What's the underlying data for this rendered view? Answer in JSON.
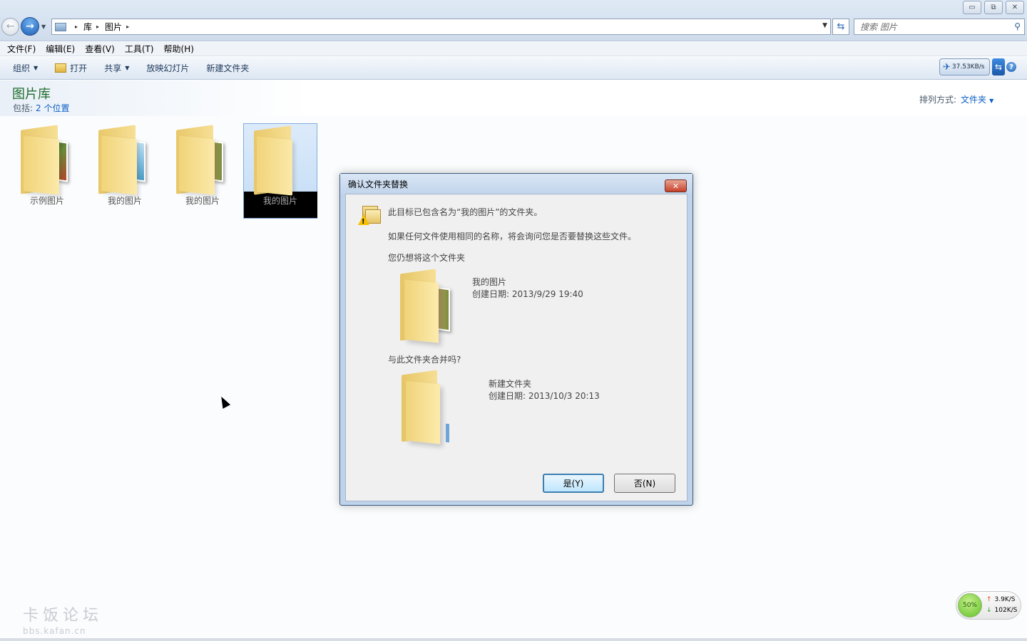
{
  "window": {
    "controls": {
      "minimize": "▭",
      "restore": "⧉",
      "close": "✕"
    }
  },
  "nav": {
    "back": "←",
    "forward": "→",
    "dropdown": "▼"
  },
  "address": {
    "crumbs": [
      "库",
      "图片"
    ],
    "separator": "▸",
    "dropdown": "▼"
  },
  "refresh": "⇆",
  "search": {
    "placeholder": "搜索 图片",
    "icon": "search-icon"
  },
  "menubar": [
    "文件(F)",
    "编辑(E)",
    "查看(V)",
    "工具(T)",
    "帮助(H)"
  ],
  "toolbar": {
    "organize": "组织",
    "open": "打开",
    "share": "共享",
    "slideshow": "放映幻灯片",
    "new_folder": "新建文件夹",
    "caret": "▼",
    "speed_value": "37.53KB/s",
    "sync_symbol": "⇆",
    "help_symbol": "?"
  },
  "library": {
    "title": "图片库",
    "includes_label": "包括:",
    "includes_link": "2 个位置",
    "sort_label": "排列方式:",
    "sort_value": "文件夹",
    "caret": "▼"
  },
  "folders": [
    {
      "label": "示例图片",
      "selected": false,
      "thumb_colors": [
        "#2f5a2a",
        "#b3472a",
        "#6c8d3b"
      ]
    },
    {
      "label": "我的图片",
      "selected": false,
      "thumb_colors": [
        "#8ec6e8",
        "#4a9cc4",
        "#d9ecf6"
      ]
    },
    {
      "label": "我的图片",
      "selected": false,
      "thumb_colors": [
        "#2b2b2b",
        "#7a8f3a",
        "#c8a070"
      ]
    },
    {
      "label": "我的图片",
      "selected": true,
      "thumb_colors": []
    }
  ],
  "dialog": {
    "title": "确认文件夹替换",
    "close_symbol": "✕",
    "message1": "此目标已包含名为“我的图片”的文件夹。",
    "message2": "如果任何文件使用相同的名称，将会询问您是否要替换这些文件。",
    "prompt": "您仍想将这个文件夹",
    "source": {
      "name": "我的图片",
      "created": "创建日期: 2013/9/29 19:40"
    },
    "merge_question": "与此文件夹合并吗?",
    "target": {
      "name": "新建文件夹",
      "created": "创建日期: 2013/10/3 20:13"
    },
    "yes_button": "是(Y)",
    "no_button": "否(N)"
  },
  "watermark": {
    "main": "卡饭论坛",
    "sub": "bbs.kafan.cn"
  },
  "netmon": {
    "percent": "50%",
    "upload": "3.9K/S",
    "download": "102K/S",
    "up_arrow": "↑",
    "down_arrow": "↓"
  },
  "colors": {
    "accent_blue": "#0b5ec4",
    "library_title_green": "#1f6b2a",
    "dialog_frame": "#bfd3ea"
  }
}
